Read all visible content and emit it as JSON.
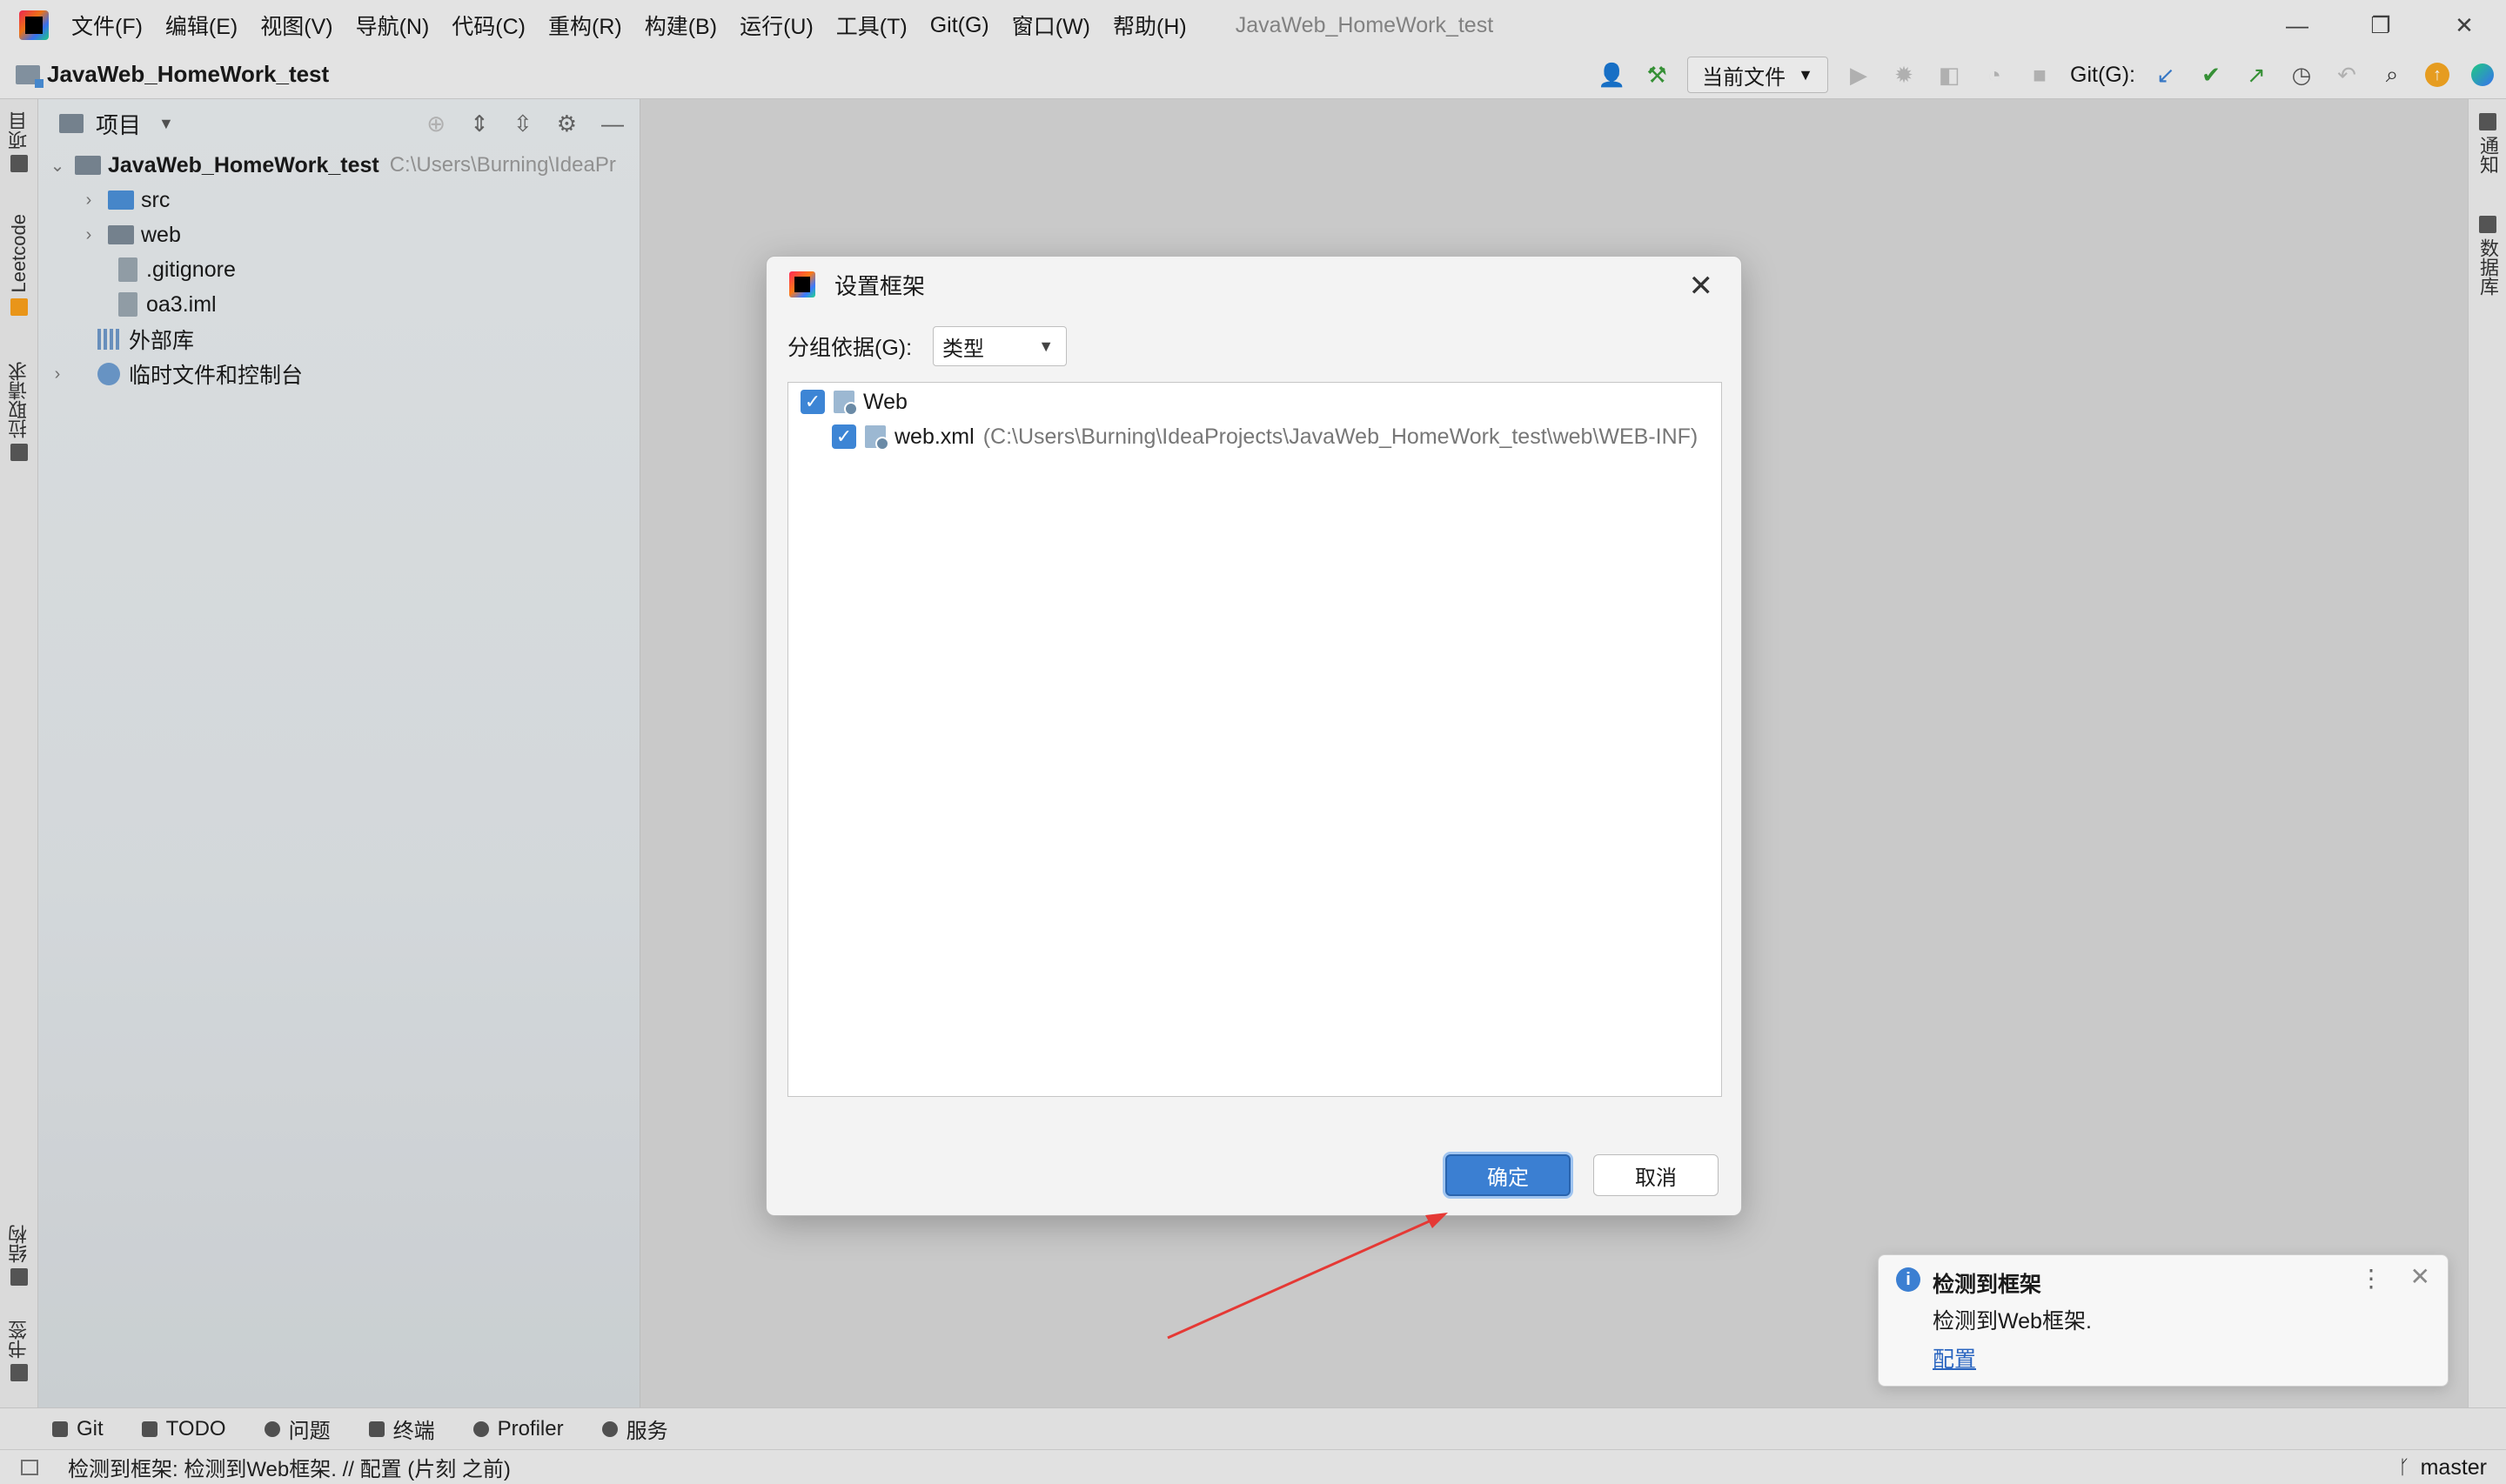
{
  "menubar": {
    "items": [
      "文件(F)",
      "编辑(E)",
      "视图(V)",
      "导航(N)",
      "代码(C)",
      "重构(R)",
      "构建(B)",
      "运行(U)",
      "工具(T)",
      "Git(G)",
      "窗口(W)",
      "帮助(H)"
    ],
    "window_title": "JavaWeb_HomeWork_test"
  },
  "navbar": {
    "project": "JavaWeb_HomeWork_test",
    "run_config": "当前文件",
    "git_label": "Git(G):"
  },
  "left_strip": {
    "tabs": [
      "项目",
      "Leetcode",
      "拉取请求",
      "结构",
      "书签"
    ]
  },
  "right_strip": {
    "tabs": [
      "通知",
      "数据库"
    ]
  },
  "project_panel": {
    "title": "项目",
    "root": {
      "name": "JavaWeb_HomeWork_test",
      "path": "C:\\Users\\Burning\\IdeaPr"
    },
    "items": [
      {
        "label": "src"
      },
      {
        "label": "web"
      },
      {
        "label": ".gitignore"
      },
      {
        "label": "oa3.iml"
      },
      {
        "label": "外部库"
      },
      {
        "label": "临时文件和控制台"
      }
    ]
  },
  "dialog": {
    "title": "设置框架",
    "group_label": "分组依据(G):",
    "group_value": "类型",
    "frameworks": [
      {
        "name": "Web",
        "checked": true
      },
      {
        "name": "web.xml",
        "path": "(C:\\Users\\Burning\\IdeaProjects\\JavaWeb_HomeWork_test\\web\\WEB-INF)",
        "checked": true
      }
    ],
    "ok_label": "确定",
    "cancel_label": "取消"
  },
  "notification": {
    "title": "检测到框架",
    "body": "检测到Web框架.",
    "link": "配置"
  },
  "bottom_tools": [
    "Git",
    "TODO",
    "问题",
    "终端",
    "Profiler",
    "服务"
  ],
  "statusbar": {
    "message": "检测到框架: 检测到Web框架. // 配置 (片刻 之前)",
    "branch": "master"
  },
  "colors": {
    "accent": "#3b7fd2",
    "annotation_arrow": "#e53935"
  }
}
